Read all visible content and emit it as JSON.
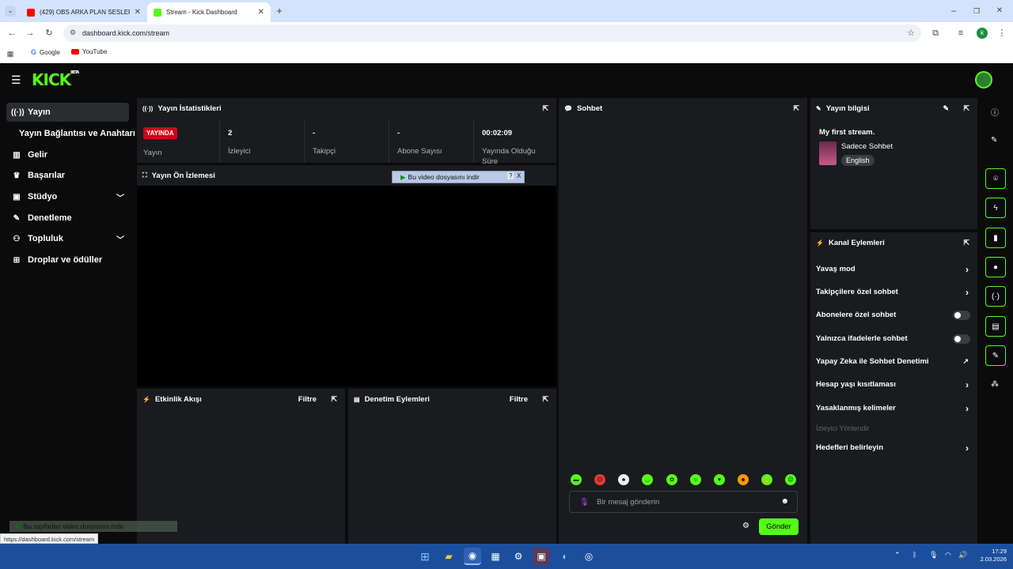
{
  "browser": {
    "tabs": [
      {
        "label": "(429) OBS ARKA PLAN SESLERİ",
        "favicon": "youtube-icon",
        "color": "#ff0000"
      },
      {
        "label": "Stream - Kick Dashboard",
        "favicon": "kick-icon",
        "color": "#53fc18"
      }
    ],
    "url": "dashboard.kick.com/stream",
    "bookmarks": [
      "Google",
      "YouTube"
    ],
    "profile_initial": "k",
    "status_url": "https://dashboard.kick.com/stream"
  },
  "kick": {
    "logo": "KICK",
    "logo_badge": "BETA",
    "accent": "#53fc18"
  },
  "sidebar": {
    "items": [
      {
        "label": "Yayın",
        "icon": "broadcast-icon"
      },
      {
        "label": "Yayın Bağlantısı ve Anahtarı"
      },
      {
        "label": "Gelir",
        "icon": "chart-icon"
      },
      {
        "label": "Başarılar",
        "icon": "trophy-icon"
      },
      {
        "label": "Stüdyo",
        "icon": "studio-icon"
      },
      {
        "label": "Denetleme",
        "icon": "wrench-icon"
      },
      {
        "label": "Topluluk",
        "icon": "people-icon"
      },
      {
        "label": "Droplar ve ödüller",
        "icon": "gift-icon"
      }
    ]
  },
  "stats": {
    "title": "Yayın İstatistikleri",
    "live_badge": "YAYINDA",
    "live_label": "Yayın",
    "viewers": {
      "value": "2",
      "label": "İzleyici"
    },
    "followers": {
      "value": "-",
      "label": "Takipçi"
    },
    "subs": {
      "value": "-",
      "label": "Abone Sayısı"
    },
    "uptime": {
      "value": "00:02:09",
      "label": "Yayında Olduğu Süre"
    }
  },
  "preview": {
    "title": "Yayın Ön İzlemesi",
    "download_bar": "Bu video dosyasını indir",
    "help": "?",
    "close": "X"
  },
  "activity": {
    "title": "Etkinlik Akışı",
    "filter": "Filtre"
  },
  "modactions": {
    "title": "Denetim Eylemleri",
    "filter": "Filtre"
  },
  "chat": {
    "title": "Sohbet",
    "placeholder": "Bir mesaj gönderin",
    "send": "Gönder"
  },
  "stream_info": {
    "title": "Yayın bilgisi",
    "stream_title": "My first stream.",
    "category": "Sadece Sohbet",
    "language": "English"
  },
  "channel_actions": {
    "title": "Kanal Eylemleri",
    "rows": [
      {
        "label": "Yavaş mod",
        "type": "chevron"
      },
      {
        "label": "Takipçilere özel sohbet",
        "type": "chevron"
      },
      {
        "label": "Abonelere özel sohbet",
        "type": "toggle"
      },
      {
        "label": "Yalnızca ifadelerle sohbet",
        "type": "toggle"
      },
      {
        "label": "Yapay Zeka ile Sohbet Denetimi",
        "type": "external"
      },
      {
        "label": "Hesap yaşı kısıtlaması",
        "type": "chevron"
      },
      {
        "label": "Yasaklanmış kelimeler",
        "type": "chevron"
      }
    ],
    "disabled_label": "İzleyici Yönlendir",
    "last_row": "Hedefleri belirleyin"
  },
  "download_bar_bottom": "Bu sayfadan video dosyasını indir",
  "taskbar": {
    "time": "17:29",
    "date": "2.03.2026"
  }
}
